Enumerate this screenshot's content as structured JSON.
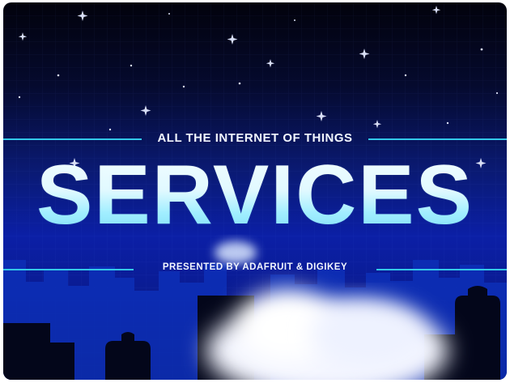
{
  "scene": {
    "subtitle": "ALL THE INTERNET OF THINGS",
    "title": "SERVICES",
    "presented_by": "PRESENTED BY ADAFRUIT & DIGIKEY"
  },
  "colors": {
    "accent_line": "#33c8e8",
    "sky_top": "#02020c",
    "sky_bottom": "#0b1fa6"
  }
}
